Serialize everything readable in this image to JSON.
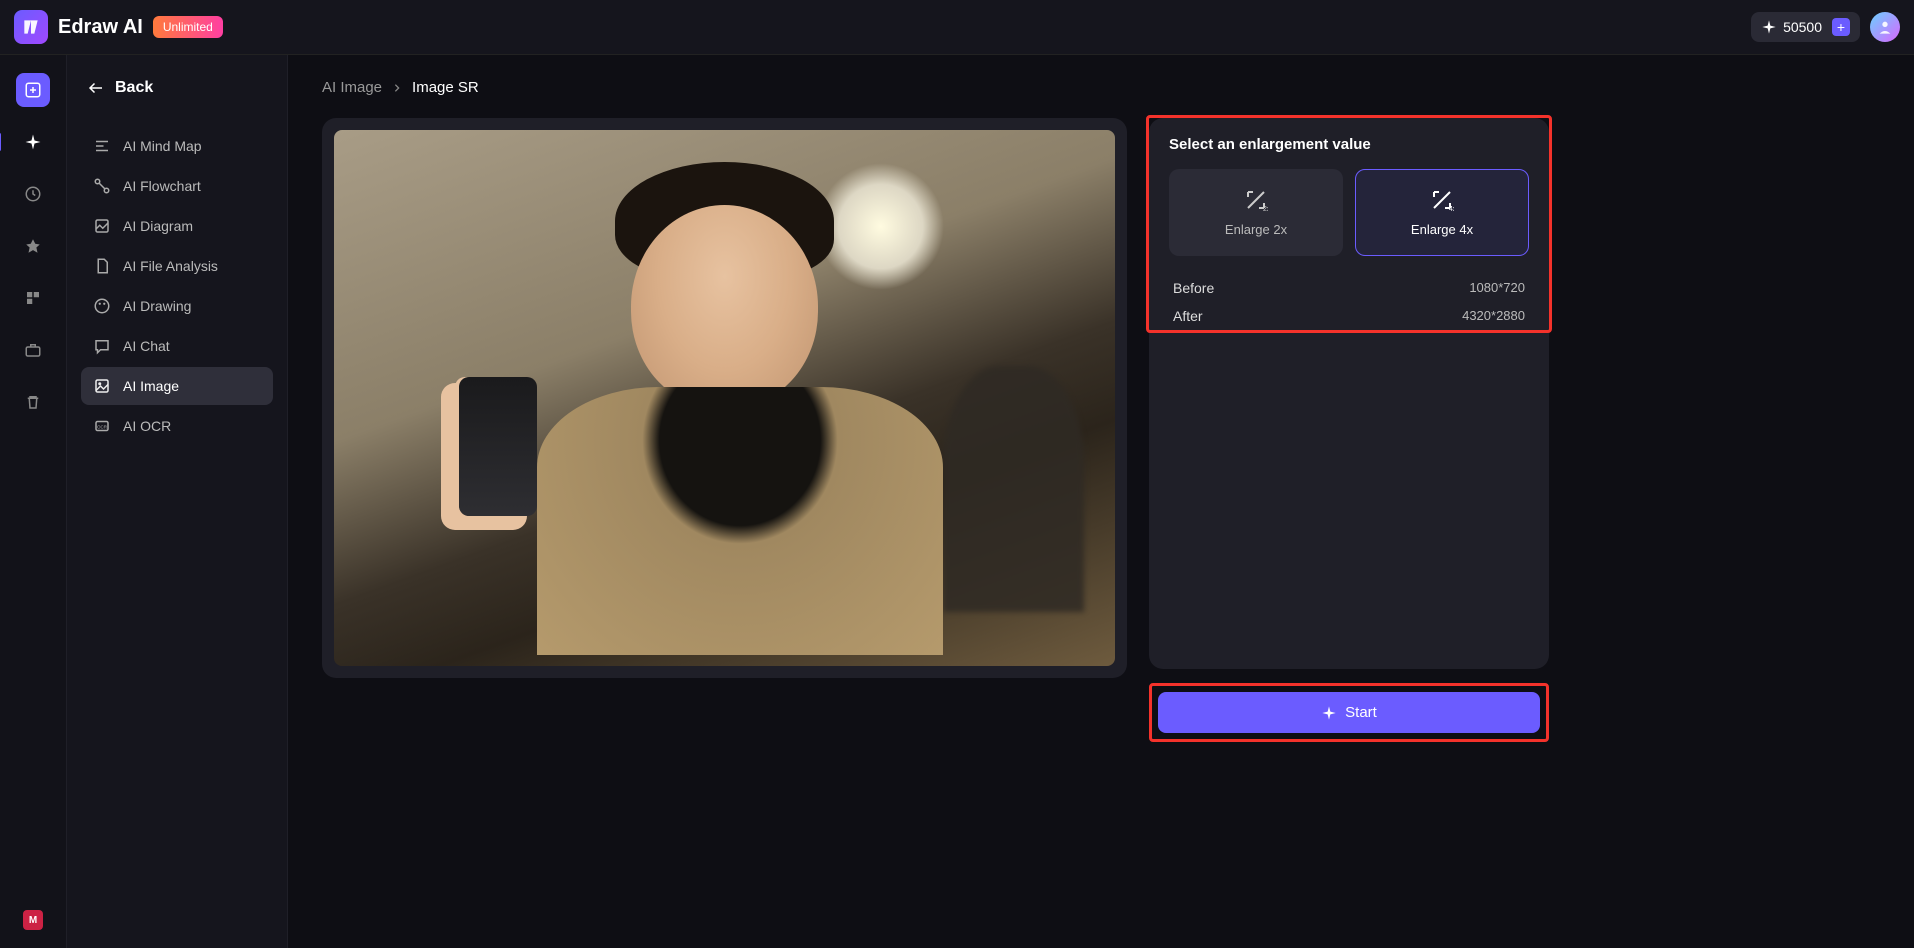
{
  "header": {
    "app_name": "Edraw AI",
    "badge": "Unlimited",
    "credits": "50500"
  },
  "sidebar": {
    "back": "Back",
    "items": [
      {
        "label": "AI Mind Map"
      },
      {
        "label": "AI Flowchart"
      },
      {
        "label": "AI Diagram"
      },
      {
        "label": "AI File Analysis"
      },
      {
        "label": "AI Drawing"
      },
      {
        "label": "AI Chat"
      },
      {
        "label": "AI Image"
      },
      {
        "label": "AI OCR"
      }
    ]
  },
  "breadcrumb": {
    "parent": "AI Image",
    "current": "Image SR"
  },
  "panel": {
    "title": "Select an enlargement value",
    "opt_2x": "Enlarge 2x",
    "opt_4x": "Enlarge 4x",
    "before_label": "Before",
    "before_value": "1080*720",
    "after_label": "After",
    "after_value": "4320*2880"
  },
  "actions": {
    "start": "Start"
  },
  "rail_bottom": "M"
}
